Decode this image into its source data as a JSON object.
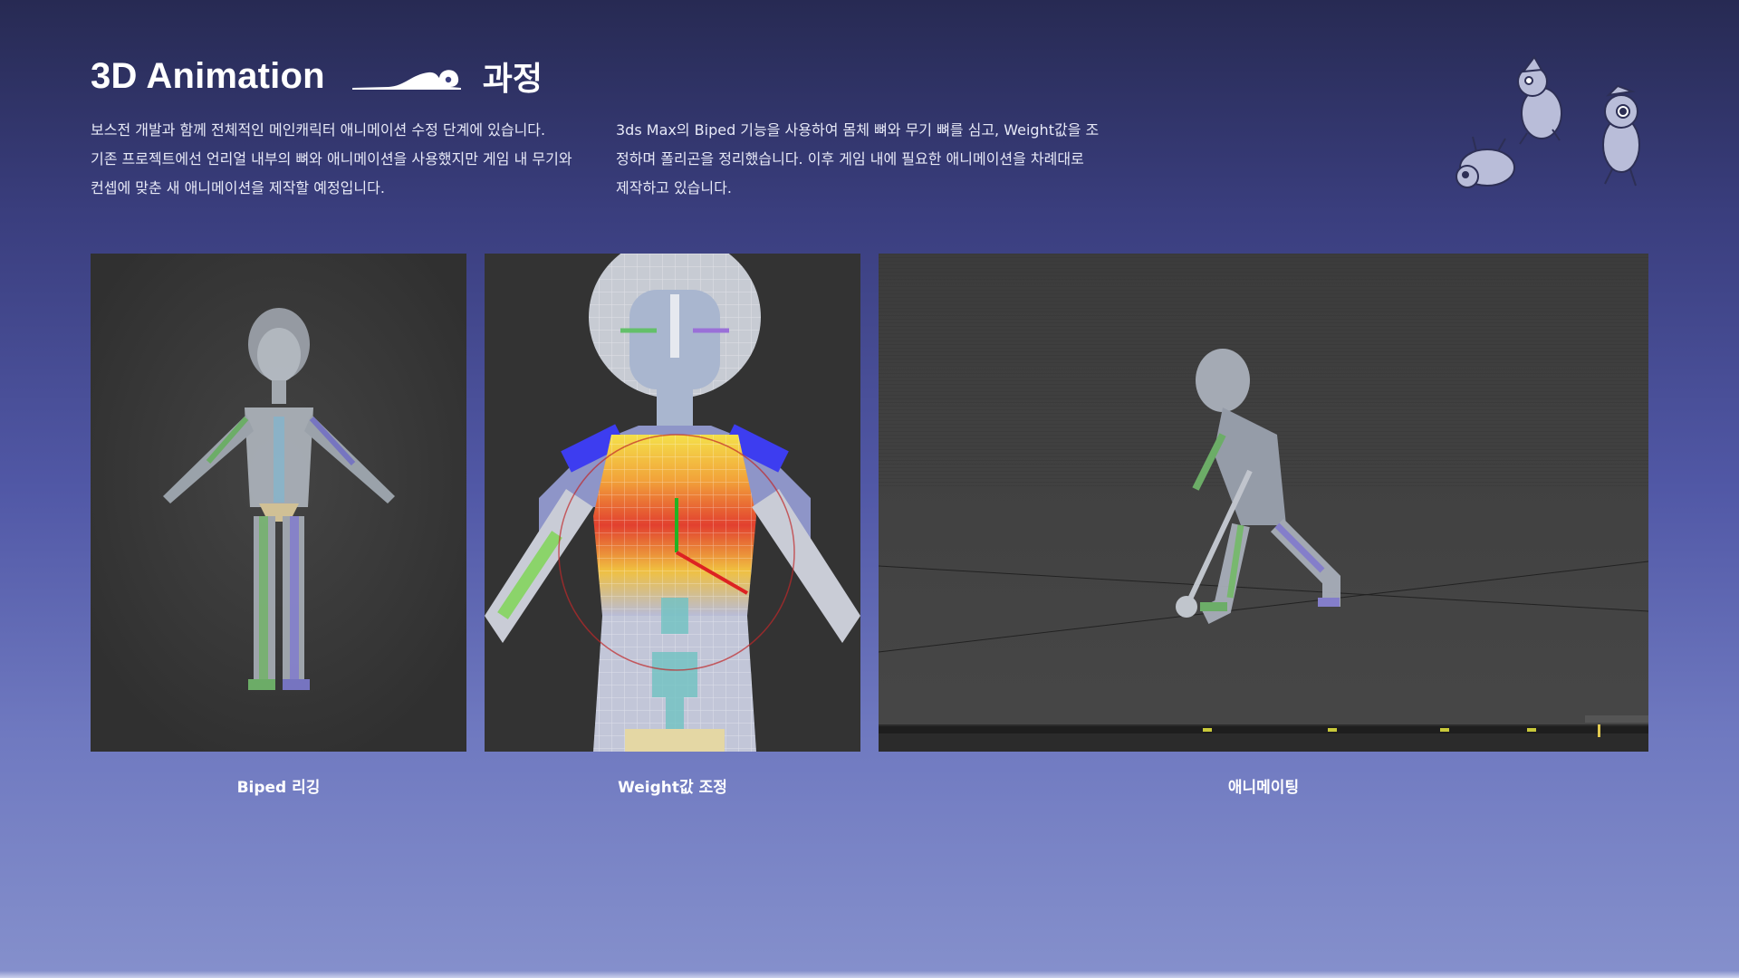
{
  "header": {
    "title_en": "3D Animation",
    "title_ko": "과정"
  },
  "description": {
    "left": [
      "보스전 개발과 함께 전체적인 메인캐릭터 애니메이션 수정 단계에 있습니다.",
      "기존 프로젝트에선 언리얼 내부의 뼈와 애니메이션을 사용했지만 게임 내 무기와",
      "컨셉에 맞춘 새 애니메이션을 제작할 예정입니다."
    ],
    "right": [
      "3ds Max의 Biped 기능을 사용하여 몸체 뼈와 무기 뼈를 심고, Weight값을 조",
      "정하며 폴리곤을 정리했습니다. 이후 게임 내에 필요한 애니메이션을 차례대로",
      "제작하고 있습니다."
    ]
  },
  "panels": [
    {
      "caption": "Biped 리깅"
    },
    {
      "caption": "Weight값 조정"
    },
    {
      "caption": "애니메이팅"
    }
  ],
  "colors": {
    "bg_top": "#272a53",
    "bg_bottom": "#8590cc",
    "viewport": "#3a3a3a",
    "text": "#ffffff"
  },
  "icons": [
    "title-wave-icon",
    "mascot-illustration"
  ]
}
